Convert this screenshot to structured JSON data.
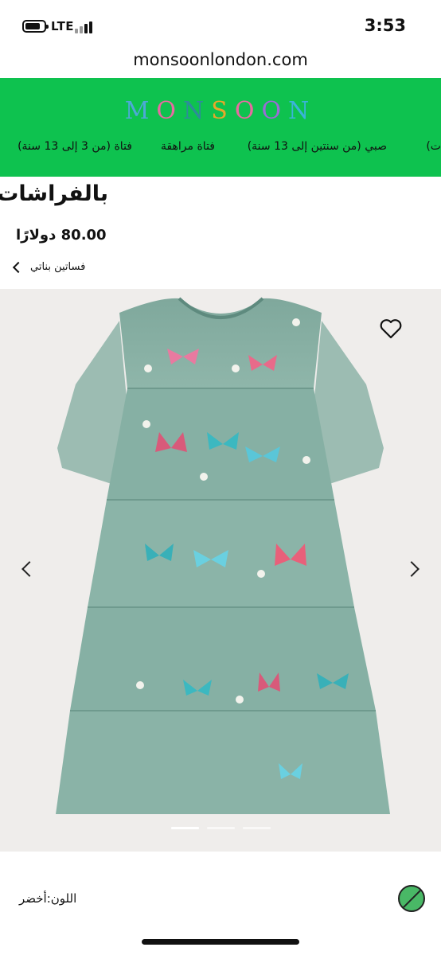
{
  "status_bar": {
    "network": "LTE",
    "time": "3:53"
  },
  "browser": {
    "url": "monsoonlondon.com"
  },
  "header": {
    "logo_letters": [
      "M",
      "O",
      "N",
      "S",
      "O",
      "O",
      "N"
    ],
    "logo_colors": [
      "#4da9d6",
      "#e86aa1",
      "#2d8c9a",
      "#e8a82a",
      "#e86aa1",
      "#9b6bd6",
      "#3ab4d8"
    ],
    "background_color": "#0ec24f",
    "nav": [
      {
        "label": "ت)"
      },
      {
        "label": "صبي (من سنتين إلى 13 سنة)"
      },
      {
        "label": "فتاة مراهقة"
      },
      {
        "label": "فتاة (من 3 إلى 13 سنة)"
      }
    ]
  },
  "product": {
    "title": "بالفراشات",
    "price": "80.00 دولارًا",
    "breadcrumb": "فساتين بناتي",
    "image_icon": "dress-with-butterflies-image",
    "gallery": {
      "slides": 3,
      "active_slide": 1
    }
  },
  "color": {
    "label": "اللون:",
    "value": "أخضر",
    "swatch_color": "#49b866"
  }
}
